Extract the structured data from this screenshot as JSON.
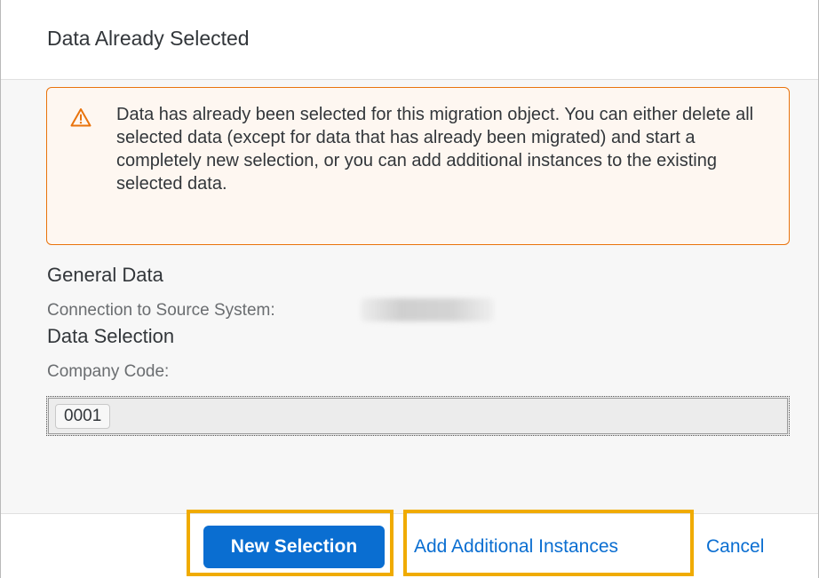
{
  "dialog": {
    "title": "Data Already Selected"
  },
  "warning": {
    "icon": "warning-triangle-icon",
    "color": "#e9730c",
    "message": "Data has already been selected for this migration object. You can either delete all selected data (except for data that has already been migrated) and start a completely new selection, or you can add additional instances to the existing selected data."
  },
  "general_data": {
    "title": "General Data",
    "connection_label": "Connection to Source System:"
  },
  "data_selection": {
    "title": "Data Selection",
    "company_code_label": "Company Code:",
    "tokens": [
      "0001"
    ]
  },
  "footer": {
    "new_selection_label": "New Selection",
    "add_instances_label": "Add Additional Instances",
    "cancel_label": "Cancel",
    "accent": "#0a6ed1",
    "highlight": "#f0ab00"
  }
}
